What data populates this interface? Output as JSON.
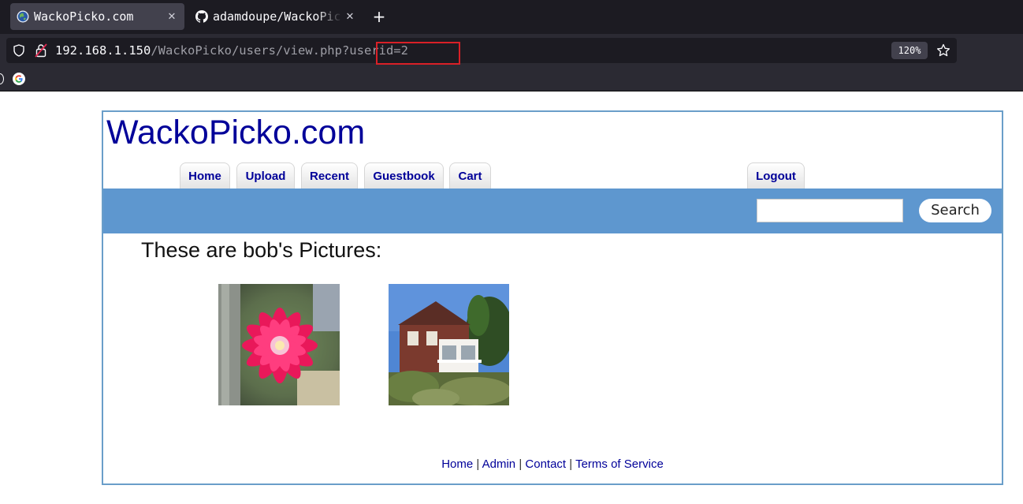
{
  "browser": {
    "tabs": [
      {
        "title": "WackoPicko.com",
        "active": true,
        "icon": "globe-icon"
      },
      {
        "title": "adamdoupe/WackoPicko",
        "active": false,
        "icon": "github-icon"
      }
    ],
    "url": {
      "host": "192.168.1.150",
      "path": "/WackoPicko/users/view.php",
      "query": "?userid=2"
    },
    "zoom": "120%",
    "bookmarks": [
      "google-icon"
    ],
    "colors": {
      "tabbar": "#1c1b22",
      "toolbar": "#2b2a33",
      "highlight_box": "#d92027"
    }
  },
  "site": {
    "title": "WackoPicko.com",
    "nav": [
      "Home",
      "Upload",
      "Recent",
      "Guestbook",
      "Cart"
    ],
    "logout": "Logout",
    "search": {
      "value": "",
      "button": "Search"
    },
    "heading": "These are bob's Pictures:",
    "pictures": [
      {
        "subject": "pink cactus flower"
      },
      {
        "subject": "red house with white porch"
      }
    ],
    "footer": {
      "links": [
        "Home",
        "Admin",
        "Contact",
        "Terms of Service"
      ],
      "separator": "|"
    },
    "colors": {
      "link": "#000099",
      "bar": "#5e97cf",
      "border": "#6a9ec9"
    }
  }
}
